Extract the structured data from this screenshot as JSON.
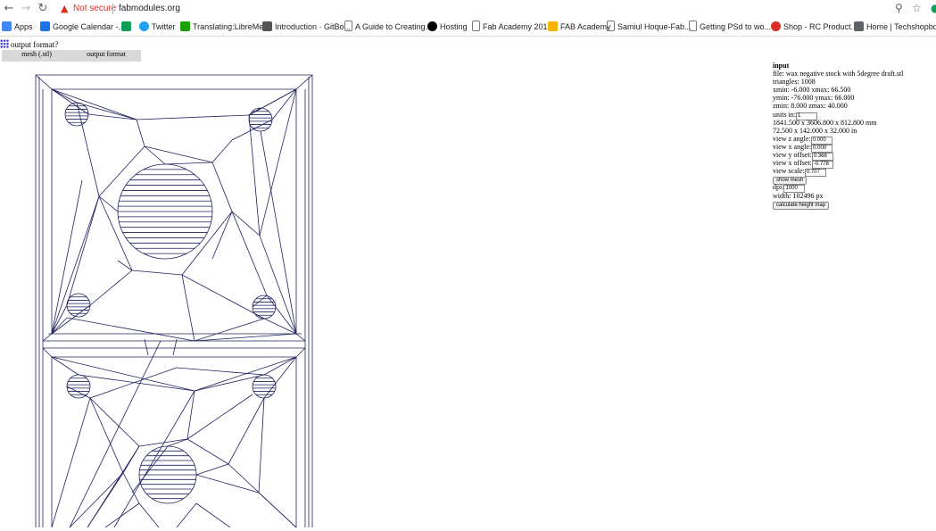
{
  "browser": {
    "security_label": "Not secure",
    "url": "fabmodules.org",
    "bookmarks": [
      {
        "label": "Apps",
        "icon": "apps-grid-icon",
        "color": "#4285f4"
      },
      {
        "label": "Google Calendar -...",
        "icon": "calendar-icon",
        "color": "#1a73e8"
      },
      {
        "label": "",
        "icon": "green-square-icon",
        "color": "#0f9d58"
      },
      {
        "label": "Twitter",
        "icon": "twitter-icon",
        "color": "#1da1f2"
      },
      {
        "label": "Translating:LibreMe...",
        "icon": "libreoffice-icon",
        "color": "#18a303"
      },
      {
        "label": "Introduction · GitBo...",
        "icon": "book-icon",
        "color": "#555555"
      },
      {
        "label": "A Guide to Creating...",
        "icon": "page-icon",
        "color": "#777777"
      },
      {
        "label": "Hosting",
        "icon": "github-icon",
        "color": "#000000"
      },
      {
        "label": "Fab Academy 2019",
        "icon": "page-icon",
        "color": "#777777"
      },
      {
        "label": "FAB Academy",
        "icon": "folder-icon",
        "color": "#f4b400"
      },
      {
        "label": "Samiul Hoque-Fab...",
        "icon": "page-icon",
        "color": "#777777"
      },
      {
        "label": "Getting PSd to wo...",
        "icon": "page-icon",
        "color": "#777777"
      },
      {
        "label": "Shop - RC Product...",
        "icon": "shop-icon",
        "color": "#d93025"
      },
      {
        "label": "Home | Techshopbd",
        "icon": "site-icon",
        "color": "#5f6368"
      }
    ]
  },
  "app": {
    "title": "output format?",
    "tabs": [
      {
        "label": "mesh (.stl)"
      },
      {
        "label": "output format"
      }
    ]
  },
  "panel": {
    "heading": "input",
    "file": "file: wax negative stock with 5degree draft.stl",
    "triangles": "triangles: 1008",
    "xrange": "xmin: -6.000 xmax: 66.500",
    "yrange": "ymin: -76.000 ymax: 66.000",
    "zrange": "zmin: 8.000 zmax: 40.000",
    "units_label": "units in:",
    "units_value": "1",
    "mm_size": "1841.500 x 3606.800 x 812.800 mm",
    "in_size": "72.500 x 142.000 x 32.000 in",
    "view_z_label": "view z angle:",
    "view_z_value": "0.000",
    "view_x_label": "view x angle:",
    "view_x_value": "0.000",
    "view_y_offset_label": "view y offset:",
    "view_y_offset_value": "0.368",
    "view_x_offset_label": "view x offset:",
    "view_x_offset_value": "-0.778",
    "view_scale_label": "view scale:",
    "view_scale_value": "0.707",
    "show_mesh": "show mesh",
    "dpi_label": "dpi:",
    "dpi_value": "1000",
    "width": "width: 102496 px",
    "calc_button": "calculate height map"
  },
  "colors": {
    "mesh_stroke": "#1f1f5e",
    "warning": "#d93025"
  }
}
